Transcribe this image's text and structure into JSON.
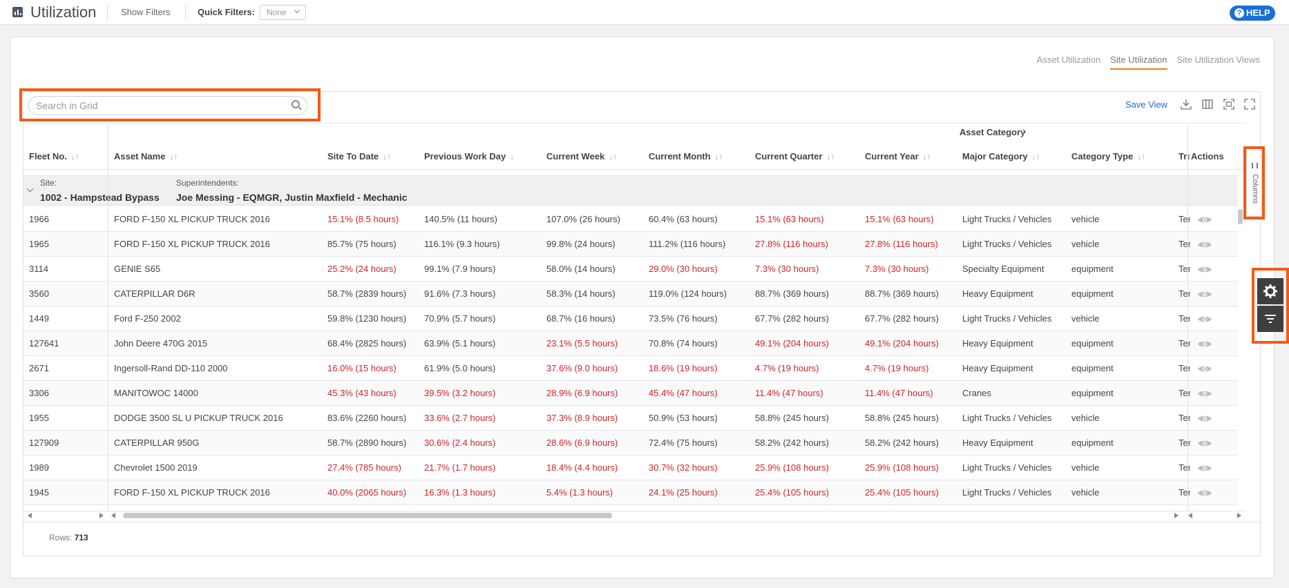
{
  "topbar": {
    "title": "Utilization",
    "show_filters": "Show Filters",
    "quick_filters_label": "Quick Filters:",
    "quick_filters_value": "None",
    "help": "HELP"
  },
  "tabs": [
    "Asset Utilization",
    "Site Utilization",
    "Site Utilization Views"
  ],
  "active_tab": "Site Utilization",
  "toolbar": {
    "search_placeholder": "Search in Grid",
    "save_view": "Save View"
  },
  "grid": {
    "group_header": "Asset Category",
    "columns": [
      "Fleet No.",
      "Asset Name",
      "Site To Date",
      "Previous Work Day",
      "Current Week",
      "Current Month",
      "Current Quarter",
      "Current Year",
      "Major Category",
      "Category Type",
      "Tra",
      "Actions"
    ],
    "group_row": {
      "site_label": "Site:",
      "site_value": "1002 - Hampstead Bypass",
      "super_label": "Superintendents:",
      "super_value": "Joe Messing - EQMGR, Justin Maxfield - Mechanic"
    },
    "rows": [
      {
        "fleet": "1966",
        "name": "FORD F-150 XL PICKUP TRUCK 2016",
        "std": "15.1% (8.5 hours)",
        "pwd": "140.5% (11 hours)",
        "cw": "107.0% (26 hours)",
        "cm": "60.4% (63 hours)",
        "cq": "15.1% (63 hours)",
        "cy": "15.1% (63 hours)",
        "major": "Light Trucks / Vehicles",
        "type": "vehicle",
        "tra": "Ter"
      },
      {
        "fleet": "1965",
        "name": "FORD F-150 XL PICKUP TRUCK 2016",
        "std": "85.7% (75 hours)",
        "pwd": "116.1% (9.3 hours)",
        "cw": "99.8% (24 hours)",
        "cm": "111.2% (116 hours)",
        "cq": "27.8% (116 hours)",
        "cy": "27.8% (116 hours)",
        "major": "Light Trucks / Vehicles",
        "type": "vehicle",
        "tra": "Ter"
      },
      {
        "fleet": "3114",
        "name": "GENIE S65",
        "std": "25.2% (24 hours)",
        "pwd": "99.1% (7.9 hours)",
        "cw": "58.0% (14 hours)",
        "cm": "29.0% (30 hours)",
        "cq": "7.3% (30 hours)",
        "cy": "7.3% (30 hours)",
        "major": "Specialty Equipment",
        "type": "equipment",
        "tra": "Ter"
      },
      {
        "fleet": "3560",
        "name": "CATERPILLAR D6R",
        "std": "58.7% (2839 hours)",
        "pwd": "91.6% (7.3 hours)",
        "cw": "58.3% (14 hours)",
        "cm": "119.0% (124 hours)",
        "cq": "88.7% (369 hours)",
        "cy": "88.7% (369 hours)",
        "major": "Heavy Equipment",
        "type": "equipment",
        "tra": "Ter"
      },
      {
        "fleet": "1449",
        "name": "Ford F-250 2002",
        "std": "59.8% (1230 hours)",
        "pwd": "70.9% (5.7 hours)",
        "cw": "68.7% (16 hours)",
        "cm": "73.5% (76 hours)",
        "cq": "67.7% (282 hours)",
        "cy": "67.7% (282 hours)",
        "major": "Light Trucks / Vehicles",
        "type": "vehicle",
        "tra": "Ter"
      },
      {
        "fleet": "127641",
        "name": "John Deere 470G 2015",
        "std": "68.4% (2825 hours)",
        "pwd": "63.9% (5.1 hours)",
        "cw": "23.1% (5.5 hours)",
        "cm": "70.8% (74 hours)",
        "cq": "49.1% (204 hours)",
        "cy": "49.1% (204 hours)",
        "major": "Heavy Equipment",
        "type": "equipment",
        "tra": "Ter"
      },
      {
        "fleet": "2671",
        "name": "Ingersoll-Rand DD-110 2000",
        "std": "16.0% (15 hours)",
        "pwd": "61.9% (5.0 hours)",
        "cw": "37.6% (9.0 hours)",
        "cm": "18.6% (19 hours)",
        "cq": "4.7% (19 hours)",
        "cy": "4.7% (19 hours)",
        "major": "Heavy Equipment",
        "type": "equipment",
        "tra": "Ter"
      },
      {
        "fleet": "3306",
        "name": "MANITOWOC 14000",
        "std": "45.3% (43 hours)",
        "pwd": "39.5% (3.2 hours)",
        "cw": "28.9% (6.9 hours)",
        "cm": "45.4% (47 hours)",
        "cq": "11.4% (47 hours)",
        "cy": "11.4% (47 hours)",
        "major": "Cranes",
        "type": "equipment",
        "tra": "Ter"
      },
      {
        "fleet": "1955",
        "name": "DODGE 3500 SL U PICKUP TRUCK 2016",
        "std": "83.6% (2260 hours)",
        "pwd": "33.6% (2.7 hours)",
        "cw": "37.3% (8.9 hours)",
        "cm": "50.9% (53 hours)",
        "cq": "58.8% (245 hours)",
        "cy": "58.8% (245 hours)",
        "major": "Light Trucks / Vehicles",
        "type": "vehicle",
        "tra": "Ter"
      },
      {
        "fleet": "127909",
        "name": "CATERPILLAR 950G",
        "std": "58.7% (2890 hours)",
        "pwd": "30.6% (2.4 hours)",
        "cw": "28.6% (6.9 hours)",
        "cm": "72.4% (75 hours)",
        "cq": "58.2% (242 hours)",
        "cy": "58.2% (242 hours)",
        "major": "Heavy Equipment",
        "type": "equipment",
        "tra": "Ter"
      },
      {
        "fleet": "1989",
        "name": "Chevrolet 1500 2019",
        "std": "27.4% (785 hours)",
        "pwd": "21.7% (1.7 hours)",
        "cw": "18.4% (4.4 hours)",
        "cm": "30.7% (32 hours)",
        "cq": "25.9% (108 hours)",
        "cy": "25.9% (108 hours)",
        "major": "Light Trucks / Vehicles",
        "type": "vehicle",
        "tra": "Ter"
      },
      {
        "fleet": "1945",
        "name": "FORD F-150 XL PICKUP TRUCK 2016",
        "std": "40.0% (2065 hours)",
        "pwd": "16.3% (1.3 hours)",
        "cw": "5.4% (1.3 hours)",
        "cm": "24.1% (25 hours)",
        "cq": "25.4% (105 hours)",
        "cy": "25.4% (105 hours)",
        "major": "Light Trucks / Vehicles",
        "type": "vehicle",
        "tra": "Ter"
      }
    ],
    "red_cells": [
      [
        "std",
        "cq",
        "cy"
      ],
      [
        "cq",
        "cy"
      ],
      [
        "std",
        "cm",
        "cq",
        "cy"
      ],
      [],
      [],
      [
        "cw",
        "cq",
        "cy"
      ],
      [
        "std",
        "cw",
        "cm",
        "cq",
        "cy"
      ],
      [
        "std",
        "pwd",
        "cw",
        "cm",
        "cq",
        "cy"
      ],
      [
        "pwd",
        "cw"
      ],
      [
        "pwd",
        "cw"
      ],
      [
        "std",
        "pwd",
        "cw",
        "cm",
        "cq",
        "cy"
      ],
      [
        "std",
        "pwd",
        "cw",
        "cm",
        "cq",
        "cy"
      ]
    ]
  },
  "footer": {
    "rows_label": "Rows:",
    "rows_count": "713"
  },
  "side": {
    "columns_label": "Columns"
  },
  "colors": {
    "accent": "#f07a1a",
    "highlight": "#f55a14",
    "link": "#1a6ed8",
    "alert_red": "#d0232b"
  }
}
